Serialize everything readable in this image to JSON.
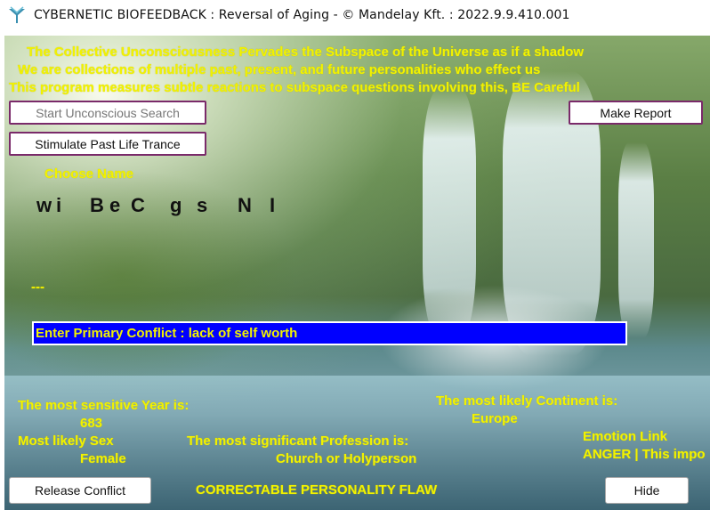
{
  "window": {
    "title": "CYBERNETIC BIOFEEDBACK : Reversal of Aging - © Mandelay Kft. : 2022.9.9.410.001",
    "icon": "app-logo-icon"
  },
  "header_lines": [
    "The Collective Unconsciousness Pervades the Subspace of the Universe as if a shadow",
    "We are collections of multiple past, present, and future personalities who effect us",
    "This program measures subtle reactions to subspace questions involving this,  BE Careful"
  ],
  "buttons": {
    "start_search": "Start Unconscious Search",
    "stimulate_trance": "Stimulate Past Life Trance",
    "make_report": "Make Report",
    "release_conflict": "Release Conflict",
    "hide": "Hide"
  },
  "choose_name": {
    "label": "Choose Name",
    "letters": [
      "w",
      "i",
      "B",
      "e",
      "C",
      "g",
      "s",
      "N",
      "I"
    ]
  },
  "dashes": "---",
  "primary_conflict": "Enter Primary Conflict : lack of self worth",
  "results": {
    "sensitive_year_label": "The most sensitive Year is:",
    "sensitive_year_value": "683",
    "sex_label": "Most likely Sex",
    "sex_value": "Female",
    "profession_label": "The most significant Profession is:",
    "profession_value": "Church or Holyperson",
    "continent_label": "The most likely Continent is:",
    "continent_value": "Europe",
    "emotion_label": "Emotion Link",
    "emotion_value": "ANGER | This impo",
    "flaw_label": "CORRECTABLE PERSONALITY FLAW"
  },
  "colors": {
    "text_yellow": "#f2f200",
    "conflict_bg": "#0000ff",
    "button_border": "#7a2a6a"
  }
}
